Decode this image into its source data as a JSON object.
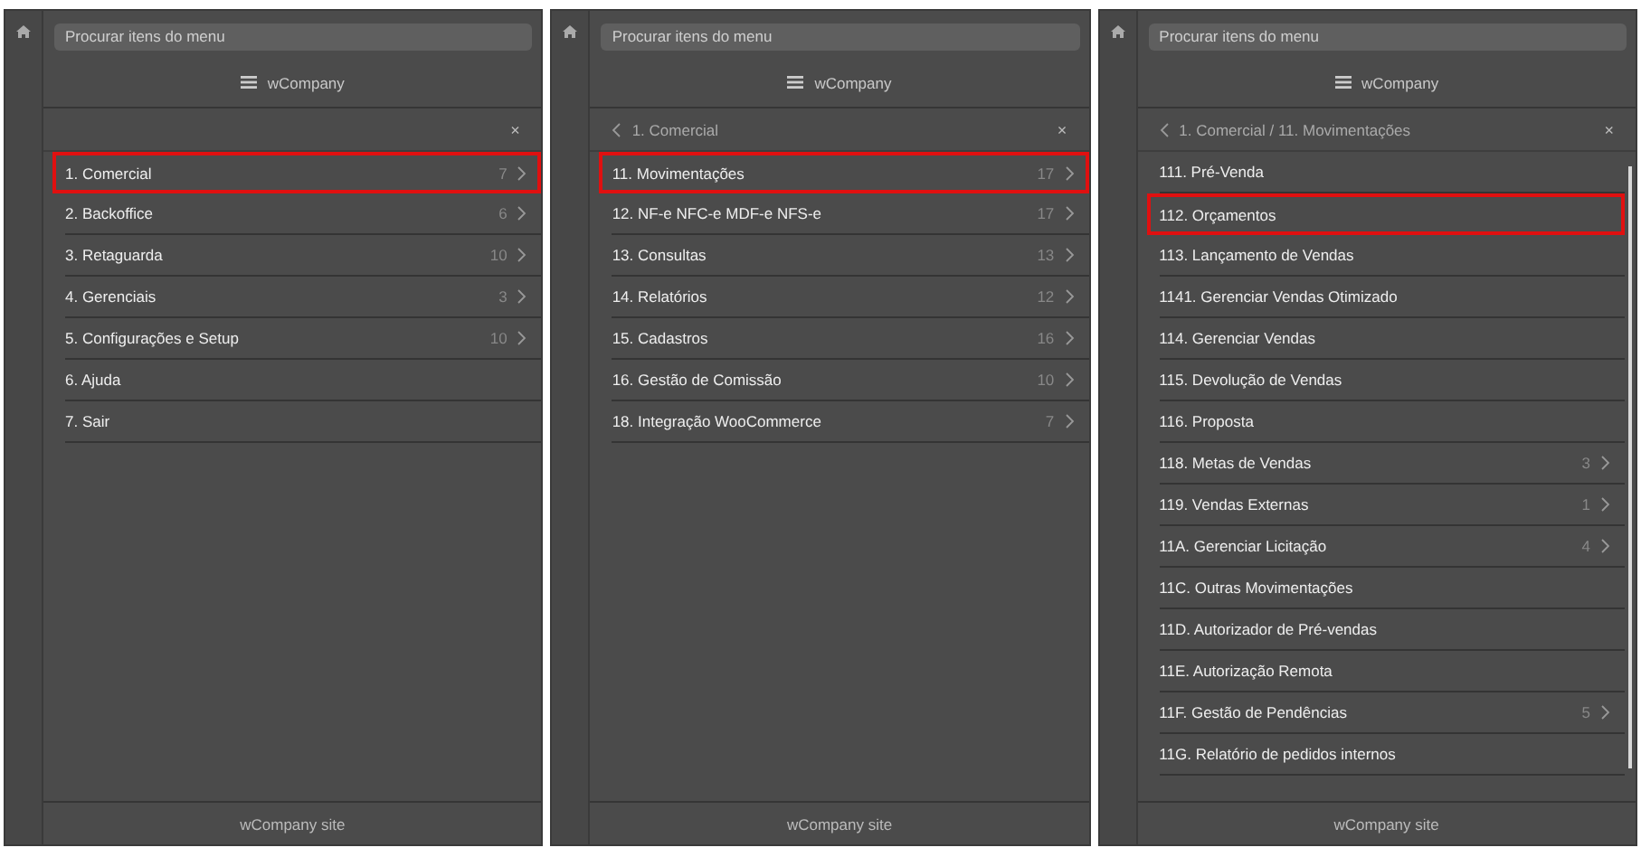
{
  "panels": [
    {
      "search": {
        "placeholder": "Procurar itens do menu"
      },
      "brand": "wCompany",
      "close": "×",
      "scrollbar": false,
      "items": [
        {
          "label": "1. Comercial",
          "count": "7",
          "selected": true
        },
        {
          "label": "2. Backoffice",
          "count": "6",
          "selected": false
        },
        {
          "label": "3. Retaguarda",
          "count": "10",
          "selected": false
        },
        {
          "label": "4. Gerenciais",
          "count": "3",
          "selected": false
        },
        {
          "label": "5. Configurações e Setup",
          "count": "10",
          "selected": false
        },
        {
          "label": "6. Ajuda",
          "selected": false
        },
        {
          "label": "7. Sair",
          "selected": false
        }
      ],
      "footer": "wCompany site"
    },
    {
      "search": {
        "placeholder": "Procurar itens do menu"
      },
      "brand": "wCompany",
      "breadcrumb": "1. Comercial",
      "close": "×",
      "scrollbar": false,
      "items": [
        {
          "label": "11. Movimentações",
          "count": "17",
          "selected": true
        },
        {
          "label": "12. NF-e NFC-e MDF-e NFS-e",
          "count": "17",
          "selected": false
        },
        {
          "label": "13. Consultas",
          "count": "13",
          "selected": false
        },
        {
          "label": "14. Relatórios",
          "count": "12",
          "selected": false
        },
        {
          "label": "15. Cadastros",
          "count": "16",
          "selected": false
        },
        {
          "label": "16. Gestão de Comissão",
          "count": "10",
          "selected": false
        },
        {
          "label": "18. Integração WooCommerce",
          "count": "7",
          "selected": false
        }
      ],
      "footer": "wCompany site"
    },
    {
      "search": {
        "placeholder": "Procurar itens do menu"
      },
      "brand": "wCompany",
      "breadcrumb": "1. Comercial / 11. Movimentações",
      "close": "×",
      "scrollbar": true,
      "items": [
        {
          "label": "111. Pré-Venda",
          "selected": false
        },
        {
          "label": "112. Orçamentos",
          "selected": true
        },
        {
          "label": "113. Lançamento de Vendas",
          "selected": false
        },
        {
          "label": "1141. Gerenciar Vendas Otimizado",
          "selected": false
        },
        {
          "label": "114. Gerenciar Vendas",
          "selected": false
        },
        {
          "label": "115. Devolução de Vendas",
          "selected": false
        },
        {
          "label": "116. Proposta",
          "selected": false
        },
        {
          "label": "118. Metas de Vendas",
          "count": "3",
          "selected": false
        },
        {
          "label": "119. Vendas Externas",
          "count": "1",
          "selected": false
        },
        {
          "label": "11A. Gerenciar Licitação",
          "count": "4",
          "selected": false
        },
        {
          "label": "11C. Outras Movimentações",
          "selected": false
        },
        {
          "label": "11D. Autorizador de Pré-vendas",
          "selected": false
        },
        {
          "label": "11E. Autorização Remota",
          "selected": false
        },
        {
          "label": "11F. Gestão de Pendências",
          "count": "5",
          "selected": false
        },
        {
          "label": "11G. Relatório de pedidos internos",
          "selected": false
        }
      ],
      "footer": "wCompany site"
    }
  ]
}
